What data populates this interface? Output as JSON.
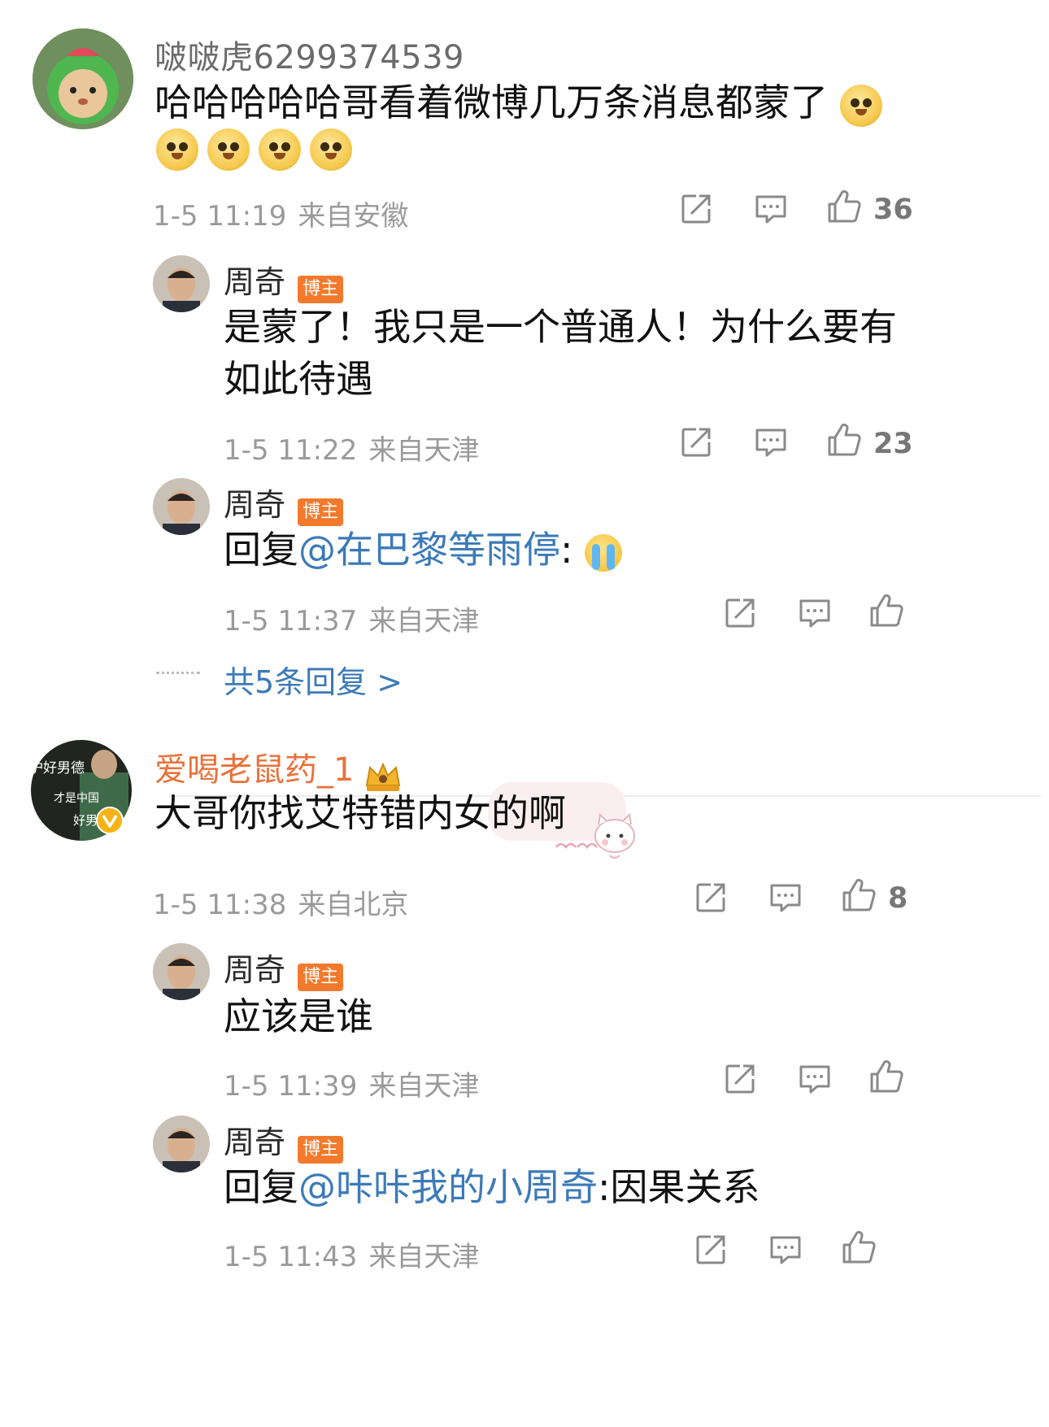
{
  "comments": [
    {
      "username": "啵啵虎6299374539",
      "text": "哈哈哈哈哈哥看着微博几万条消息都蒙了",
      "date": "1-5 11:19",
      "location": "来自安徽",
      "likes": "36",
      "replies": [
        {
          "name": "周奇",
          "badge": "博主",
          "text_line1": "是蒙了！我只是一个普通人！为什么要有",
          "text_line2": "如此待遇",
          "date": "1-5 11:22",
          "location": "来自天津",
          "likes": "23"
        },
        {
          "name": "周奇",
          "badge": "博主",
          "reply_prefix": "回复",
          "mention": "@在巴黎等雨停",
          "text": ":",
          "date": "1-5 11:37",
          "location": "来自天津"
        }
      ],
      "more_replies": "共5条回复 >"
    },
    {
      "username": "爱喝老鼠药_1",
      "text": "大哥你找艾特错内女的啊",
      "avatar_text_1": "护好男德",
      "avatar_text_2": "才是中国",
      "avatar_text_3": "好男",
      "date": "1-5 11:38",
      "location": "来自北京",
      "likes": "8",
      "replies": [
        {
          "name": "周奇",
          "badge": "博主",
          "text": "应该是谁",
          "date": "1-5 11:39",
          "location": "来自天津"
        },
        {
          "name": "周奇",
          "badge": "博主",
          "reply_prefix": "回复",
          "mention": "@咔咔我的小周奇",
          "text": ":因果关系",
          "date": "1-5 11:43",
          "location": "来自天津"
        }
      ]
    }
  ],
  "icons": {
    "share": "share-icon",
    "comment": "comment-icon",
    "like": "thumbs-up-icon",
    "doge": "doge-emoji",
    "cry": "crying-emoji",
    "crown": "crown-icon",
    "verified": "verified-icon"
  },
  "colors": {
    "link": "#3c7ab8",
    "badge": "#f37a2c",
    "vip_name": "#e8723b",
    "meta": "#9a9a9a"
  }
}
